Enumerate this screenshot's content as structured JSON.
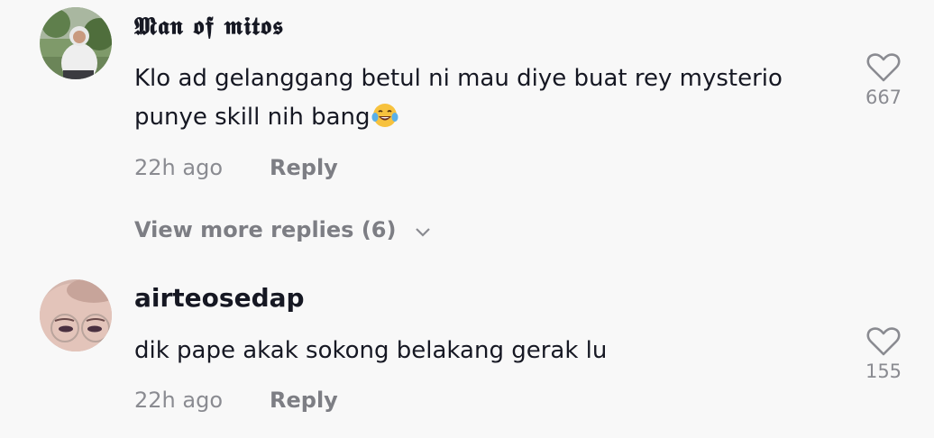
{
  "comments": [
    {
      "username": "𝕸𝖆𝖓 𝖔𝖋 𝖒𝖎𝖙𝖔𝖘",
      "text_line1": "Klo ad gelanggang betul ni mau diye buat rey mysterio",
      "text_line2": "punye skill nih bang",
      "emoji": "face-with-tears-of-joy",
      "time": "22h ago",
      "reply_label": "Reply",
      "likes": "667",
      "avatar": "avatar-person-in-white-hoodie"
    },
    {
      "username": "airteosedap",
      "text_line1": "dik pape akak sokong belakang gerak lu",
      "time": "22h ago",
      "reply_label": "Reply",
      "likes": "155",
      "avatar": "avatar-face-with-round-glasses"
    }
  ],
  "view_more": {
    "label": "View more replies (6)",
    "icon": "chevron-down-icon"
  },
  "colors": {
    "background": "#f8f8f8",
    "text": "#161823",
    "secondary": "#8a8b91"
  }
}
